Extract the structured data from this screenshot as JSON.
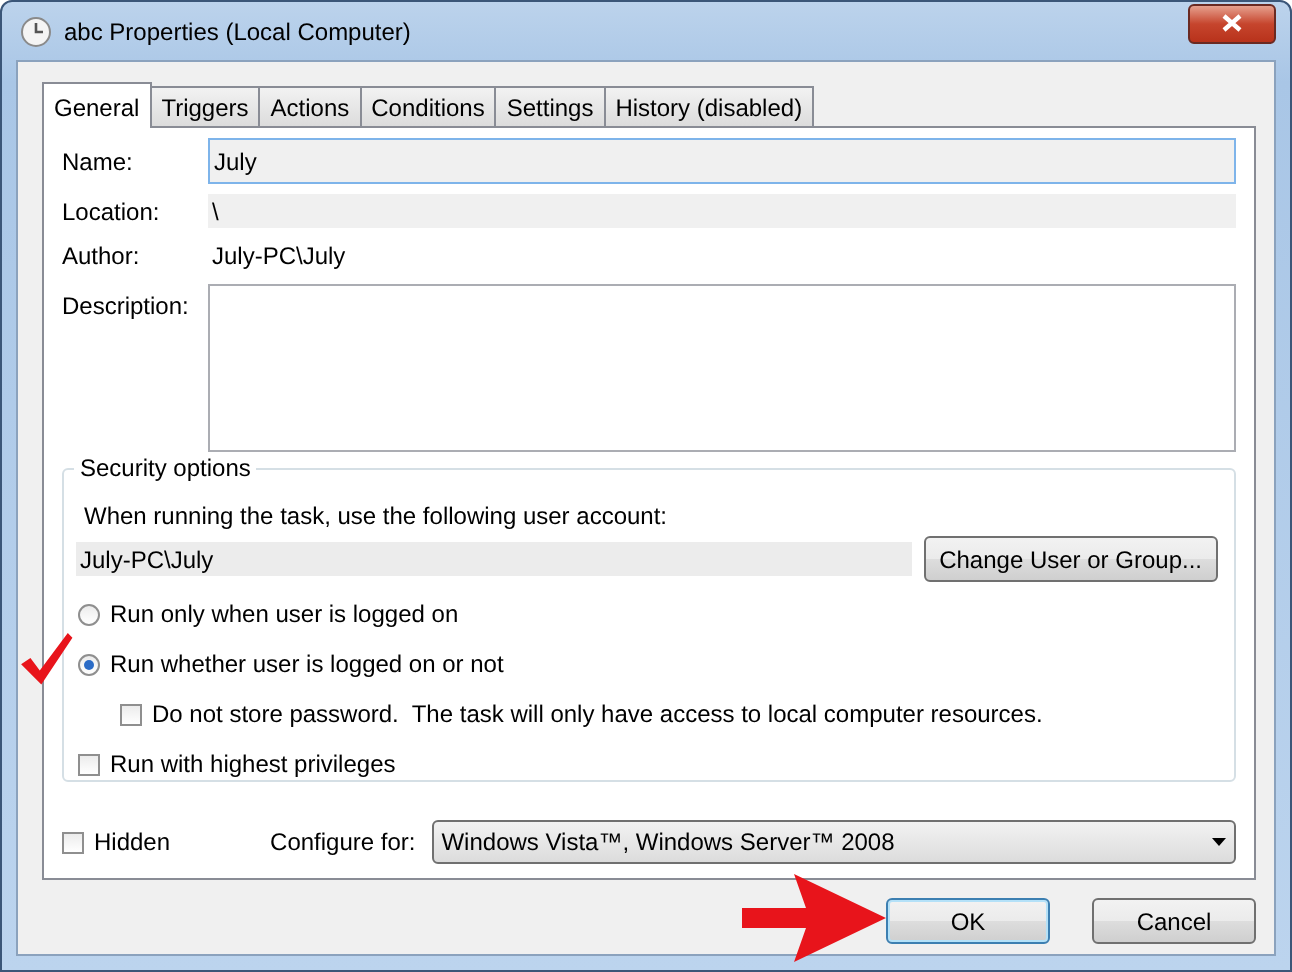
{
  "window": {
    "title": "abc Properties (Local Computer)"
  },
  "tabs": [
    {
      "label": "General",
      "selected": true
    },
    {
      "label": "Triggers",
      "selected": false
    },
    {
      "label": "Actions",
      "selected": false
    },
    {
      "label": "Conditions",
      "selected": false
    },
    {
      "label": "Settings",
      "selected": false
    },
    {
      "label": "History (disabled)",
      "selected": false
    }
  ],
  "fields": [
    {
      "kind": "input",
      "label": "Name:",
      "value": "July"
    },
    {
      "kind": "readonly",
      "label": "Location:",
      "value": "\\"
    },
    {
      "kind": "text",
      "label": "Author:",
      "value": "July-PC\\July"
    },
    {
      "kind": "textarea",
      "label": "Description:"
    }
  ],
  "security": {
    "title": "Security options",
    "prompt": "When running the task, use the following user account:",
    "account": "July-PC\\July",
    "change_button": "Change User or Group...",
    "options": [
      {
        "kind": "radio",
        "label": "Run only when user is logged on",
        "selected": false
      },
      {
        "kind": "radio",
        "label": "Run whether user is logged on or not",
        "selected": true,
        "children": [
          {
            "kind": "checkbox",
            "label": "Do not store password.  The task will only have access to local computer resources.",
            "checked": false
          }
        ]
      },
      {
        "kind": "checkbox",
        "label": "Run with highest privileges",
        "checked": false
      }
    ]
  },
  "hidden": {
    "label": "Hidden",
    "checked": false
  },
  "configure": {
    "label": "Configure for:",
    "value": "Windows Vista™, Windows Server™ 2008"
  },
  "buttons": [
    {
      "label": "OK",
      "default": true
    },
    {
      "label": "Cancel",
      "default": false
    }
  ],
  "annotations": [
    {
      "kind": "checkmark"
    },
    {
      "kind": "arrow"
    }
  ]
}
